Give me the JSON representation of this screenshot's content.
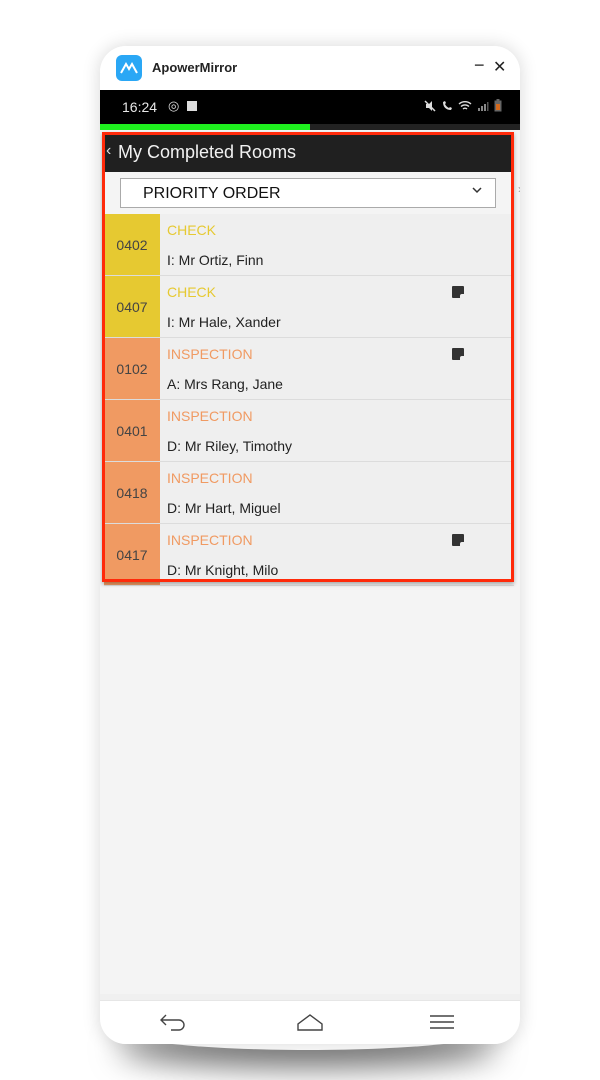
{
  "window": {
    "app_name": "ApowerMirror",
    "minimize_label": "−",
    "close_label": "✕"
  },
  "statusbar": {
    "time": "16:24",
    "left_icons": [
      "at-icon",
      "checkbox-icon"
    ],
    "right_icons": [
      "mute-icon",
      "wifi-call-icon",
      "wifi-icon",
      "signal-icon",
      "battery-icon"
    ]
  },
  "progress": {
    "value_percent": 50
  },
  "header": {
    "back_glyph": "‹",
    "title": "My Completed Rooms"
  },
  "filter": {
    "selected": "PRIORITY ORDER",
    "chevron": "⌄"
  },
  "colors": {
    "check": "#e6c931",
    "inspection": "#f09a62",
    "check_text": "#e6c931",
    "inspection_text": "#f09a62",
    "outline": "#ff2a0a",
    "progress": "#1ef01e"
  },
  "rooms": [
    {
      "number": "0402",
      "type": "CHECK",
      "status": "check",
      "guest": "I: Mr Ortiz, Finn",
      "has_note": false
    },
    {
      "number": "0407",
      "type": "CHECK",
      "status": "check",
      "guest": "I: Mr Hale, Xander",
      "has_note": true
    },
    {
      "number": "0102",
      "type": "INSPECTION",
      "status": "inspection",
      "guest": "A: Mrs Rang, Jane",
      "has_note": true
    },
    {
      "number": "0401",
      "type": "INSPECTION",
      "status": "inspection",
      "guest": "D: Mr Riley, Timothy",
      "has_note": false
    },
    {
      "number": "0418",
      "type": "INSPECTION",
      "status": "inspection",
      "guest": "D: Mr Hart, Miguel",
      "has_note": false
    },
    {
      "number": "0417",
      "type": "INSPECTION",
      "status": "inspection",
      "guest": "D: Mr Knight, Milo",
      "has_note": true
    }
  ],
  "android_nav": {
    "recents": "|||",
    "home": "◯",
    "back": "‹"
  },
  "mirror_controls": {
    "back": "back-arrow-icon",
    "home": "home-icon",
    "menu": "menu-icon"
  }
}
